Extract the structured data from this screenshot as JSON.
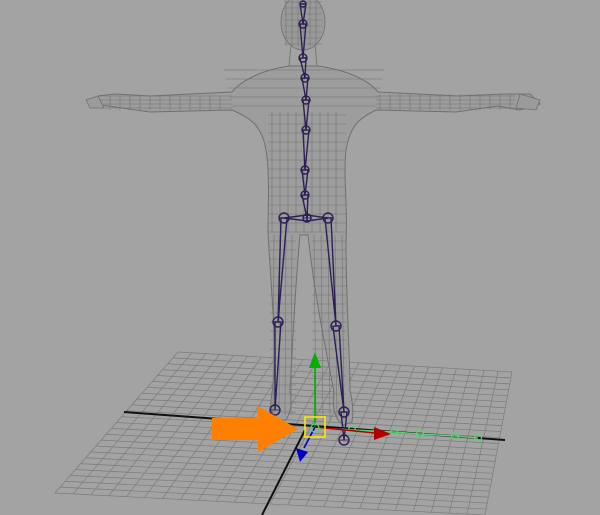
{
  "viewport": {
    "background": "#a3a3a3",
    "grid_color": "#7b7b7b",
    "wireframe_color": "#6f6f6f",
    "joint_color": "#2e1f54",
    "axis_x_color": "#b00000",
    "axis_y_color": "#00b000",
    "axis_z_color": "#0000c8",
    "ik_handle_color": "#5ed07b",
    "selection_color": "#ffe600",
    "arrow_color": "#ff7f00"
  },
  "icons": {
    "arrow": "orange-right-arrow-icon",
    "move_manipulator": "move-manipulator-icon",
    "ik_chain": "ik-chain-icon"
  }
}
